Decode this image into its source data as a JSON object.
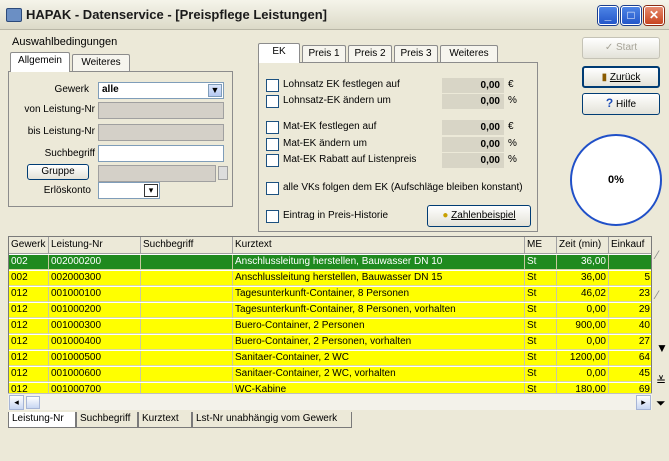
{
  "window": {
    "title": "HAPAK - Datenservice - [Preispflege Leistungen]",
    "min": "_",
    "max": "□",
    "close": "✕"
  },
  "filter": {
    "group_label": "Auswahlbedingungen",
    "tabs": [
      "Allgemein",
      "Weiteres"
    ],
    "gewerk_label": "Gewerk",
    "gewerk_value": "alle",
    "von_label": "von Leistung-Nr",
    "bis_label": "bis Leistung-Nr",
    "such_label": "Suchbegriff",
    "gruppe_button": "Gruppe",
    "erlos_label": "Erlöskonto"
  },
  "ek": {
    "tabs": [
      "EK",
      "Preis 1",
      "Preis 2",
      "Preis 3",
      "Weiteres"
    ],
    "rows": [
      {
        "label": "Lohnsatz EK festlegen auf",
        "value": "0,00",
        "unit": "€"
      },
      {
        "label": "Lohnsatz-EK ändern um",
        "value": "0,00",
        "unit": "%"
      },
      {
        "label": "Mat-EK festlegen auf",
        "value": "0,00",
        "unit": "€"
      },
      {
        "label": "Mat-EK ändern um",
        "value": "0,00",
        "unit": "%"
      },
      {
        "label": "Mat-EK Rabatt auf Listenpreis",
        "value": "0,00",
        "unit": "%"
      }
    ],
    "follow_label": "alle VKs folgen dem EK (Aufschläge bleiben konstant)",
    "history_label": "Eintrag in Preis-Historie",
    "zahlen_button": "Zahlenbeispiel"
  },
  "actions": {
    "start": "Start",
    "zurueck": "Zurück",
    "hilfe": "Hilfe"
  },
  "progress": "0%",
  "table": {
    "headers": [
      "Gewerk",
      "Leistung-Nr",
      "Suchbegriff",
      "Kurztext",
      "ME",
      "Zeit (min)",
      "Einkauf"
    ],
    "rows": [
      [
        "002",
        "002000200",
        "",
        "Anschlussleitung herstellen, Bauwasser DN 10",
        "St",
        "36,00",
        ""
      ],
      [
        "002",
        "002000300",
        "",
        "Anschlussleitung herstellen, Bauwasser DN 15",
        "St",
        "36,00",
        "5"
      ],
      [
        "012",
        "001000100",
        "",
        "Tagesunterkunft-Container, 8 Personen",
        "St",
        "46,02",
        "23"
      ],
      [
        "012",
        "001000200",
        "",
        "Tagesunterkunft-Container, 8 Personen, vorhalten",
        "St",
        "0,00",
        "29"
      ],
      [
        "012",
        "001000300",
        "",
        "Buero-Container, 2 Personen",
        "St",
        "900,00",
        "40"
      ],
      [
        "012",
        "001000400",
        "",
        "Buero-Container, 2 Personen, vorhalten",
        "St",
        "0,00",
        "27"
      ],
      [
        "012",
        "001000500",
        "",
        "Sanitaer-Container, 2 WC",
        "St",
        "1200,00",
        "64"
      ],
      [
        "012",
        "001000600",
        "",
        "Sanitaer-Container, 2 WC, vorhalten",
        "St",
        "0,00",
        "45"
      ],
      [
        "012",
        "001000700",
        "",
        "WC-Kabine",
        "St",
        "180,00",
        "69"
      ]
    ]
  },
  "bottom_tabs": [
    "Leistung-Nr",
    "Suchbegriff",
    "Kurztext",
    "Lst-Nr unabhängig vom Gewerk"
  ],
  "colors": {
    "selected_row": "#1f8a1f",
    "row_bg": "#ffff00"
  }
}
